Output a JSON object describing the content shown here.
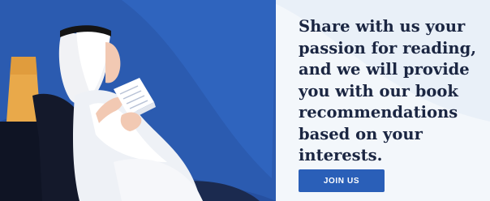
{
  "banner": {
    "headline": "Share with us your\npassion for reading,\nand we will provide\nyou with our book\nrecommendations\nbased on your interests.",
    "cta_label": "JOIN US"
  },
  "colors": {
    "panel_bg": "#f1f6fb",
    "scene_blue": "#2b5bb0",
    "dark_navy": "#1b2642",
    "cta_bg": "#2a5fb8",
    "lamp_orange": "#e9a94a"
  },
  "icons": [
    "man-reading-illustration",
    "lamp-illustration",
    "armchair-illustration",
    "book-illustration"
  ]
}
